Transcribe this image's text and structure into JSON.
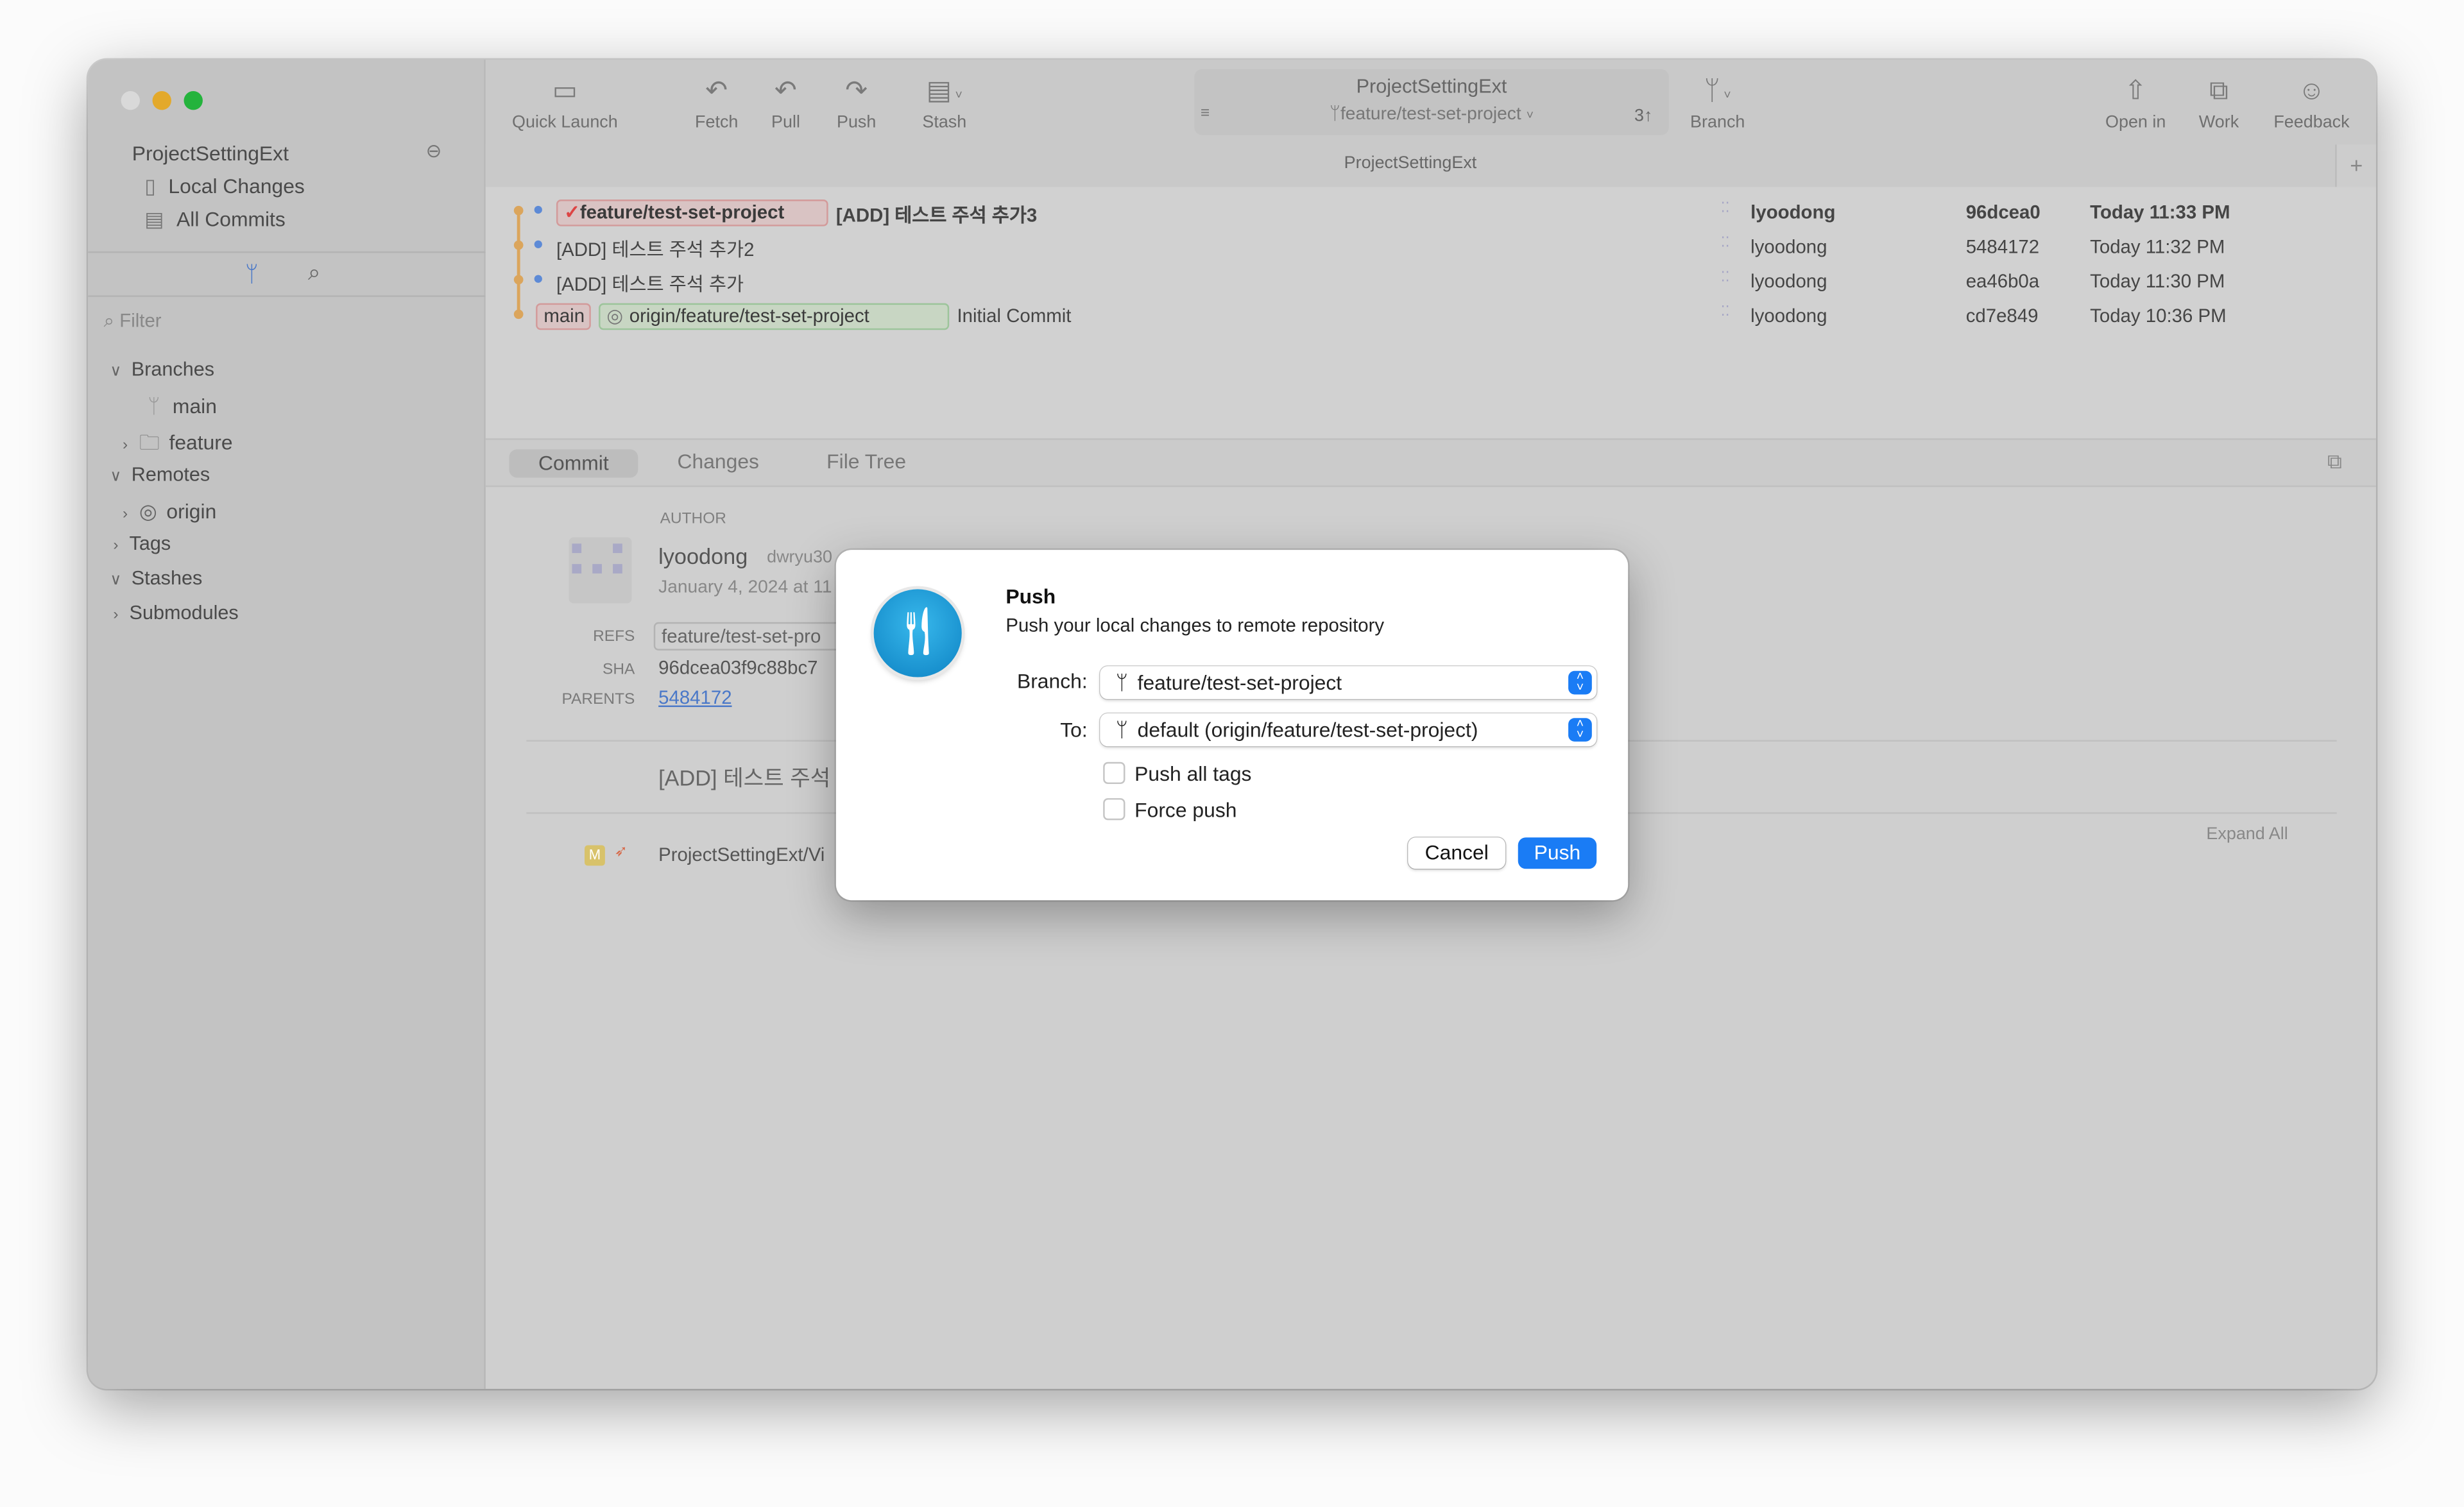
{
  "window": {
    "traffic_lights": [
      "#d9d9d9",
      "#febc2e",
      "#28c840"
    ]
  },
  "sidebar": {
    "repo_name": "ProjectSettingExt",
    "items": [
      {
        "label": "Local Changes"
      },
      {
        "label": "All Commits"
      }
    ],
    "filter_placeholder": "Filter",
    "tree": {
      "branches": "Branches",
      "branch_main": "main",
      "branch_feature": "feature",
      "remotes": "Remotes",
      "remote_origin": "origin",
      "tags": "Tags",
      "stashes": "Stashes",
      "submodules": "Submodules"
    }
  },
  "toolbar": {
    "quick_launch": "Quick Launch",
    "fetch": "Fetch",
    "pull": "Pull",
    "push": "Push",
    "stash": "Stash",
    "repo_title": "ProjectSettingExt",
    "current_branch": "feature/test-set-project",
    "ahead": "3↑",
    "branch": "Branch",
    "open_in": "Open in",
    "work": "Work",
    "feedback": "Feedback"
  },
  "tabbar": {
    "tab_title": "ProjectSettingExt",
    "add": "+"
  },
  "commits": [
    {
      "refs": [
        "feature/test-set-project"
      ],
      "message": "[ADD] 테스트 주석 추가3",
      "author": "lyoodong",
      "sha": "96dcea0",
      "date": "Today 11:33 PM"
    },
    {
      "refs": [],
      "message": "[ADD] 테스트 주석 추가2",
      "author": "lyoodong",
      "sha": "5484172",
      "date": "Today 11:32 PM"
    },
    {
      "refs": [],
      "message": "[ADD] 테스트 주석 추가",
      "author": "lyoodong",
      "sha": "ea46b0a",
      "date": "Today 11:30 PM"
    },
    {
      "refs": [
        "main",
        "origin/feature/test-set-project"
      ],
      "message": "Initial Commit",
      "author": "lyoodong",
      "sha": "cd7e849",
      "date": "Today 10:36 PM"
    }
  ],
  "detail_tabs": [
    "Commit",
    "Changes",
    "File Tree"
  ],
  "detail": {
    "author_label": "AUTHOR",
    "author": "lyoodong",
    "email": "dwryu30",
    "date": "January 4, 2024 at 11",
    "refs_label": "REFS",
    "refs": "feature/test-set-pro",
    "sha_label": "SHA",
    "sha": "96dcea03f9c88bc7",
    "parents_label": "PARENTS",
    "parents": "5484172",
    "message": "[ADD] 테스트 주석",
    "file_status": "M",
    "file_path": "ProjectSettingExt/Vi",
    "expand_all": "Expand All"
  },
  "dialog": {
    "title": "Push",
    "subtitle": "Push your local changes to remote repository",
    "branch_label": "Branch:",
    "branch_value": "feature/test-set-project",
    "to_label": "To:",
    "to_value": "default (origin/feature/test-set-project)",
    "push_all_tags": "Push all tags",
    "push_all_tags_checked": false,
    "force_push": "Force push",
    "force_push_checked": false,
    "cancel": "Cancel",
    "push": "Push",
    "accent": "#1a7cf5"
  }
}
